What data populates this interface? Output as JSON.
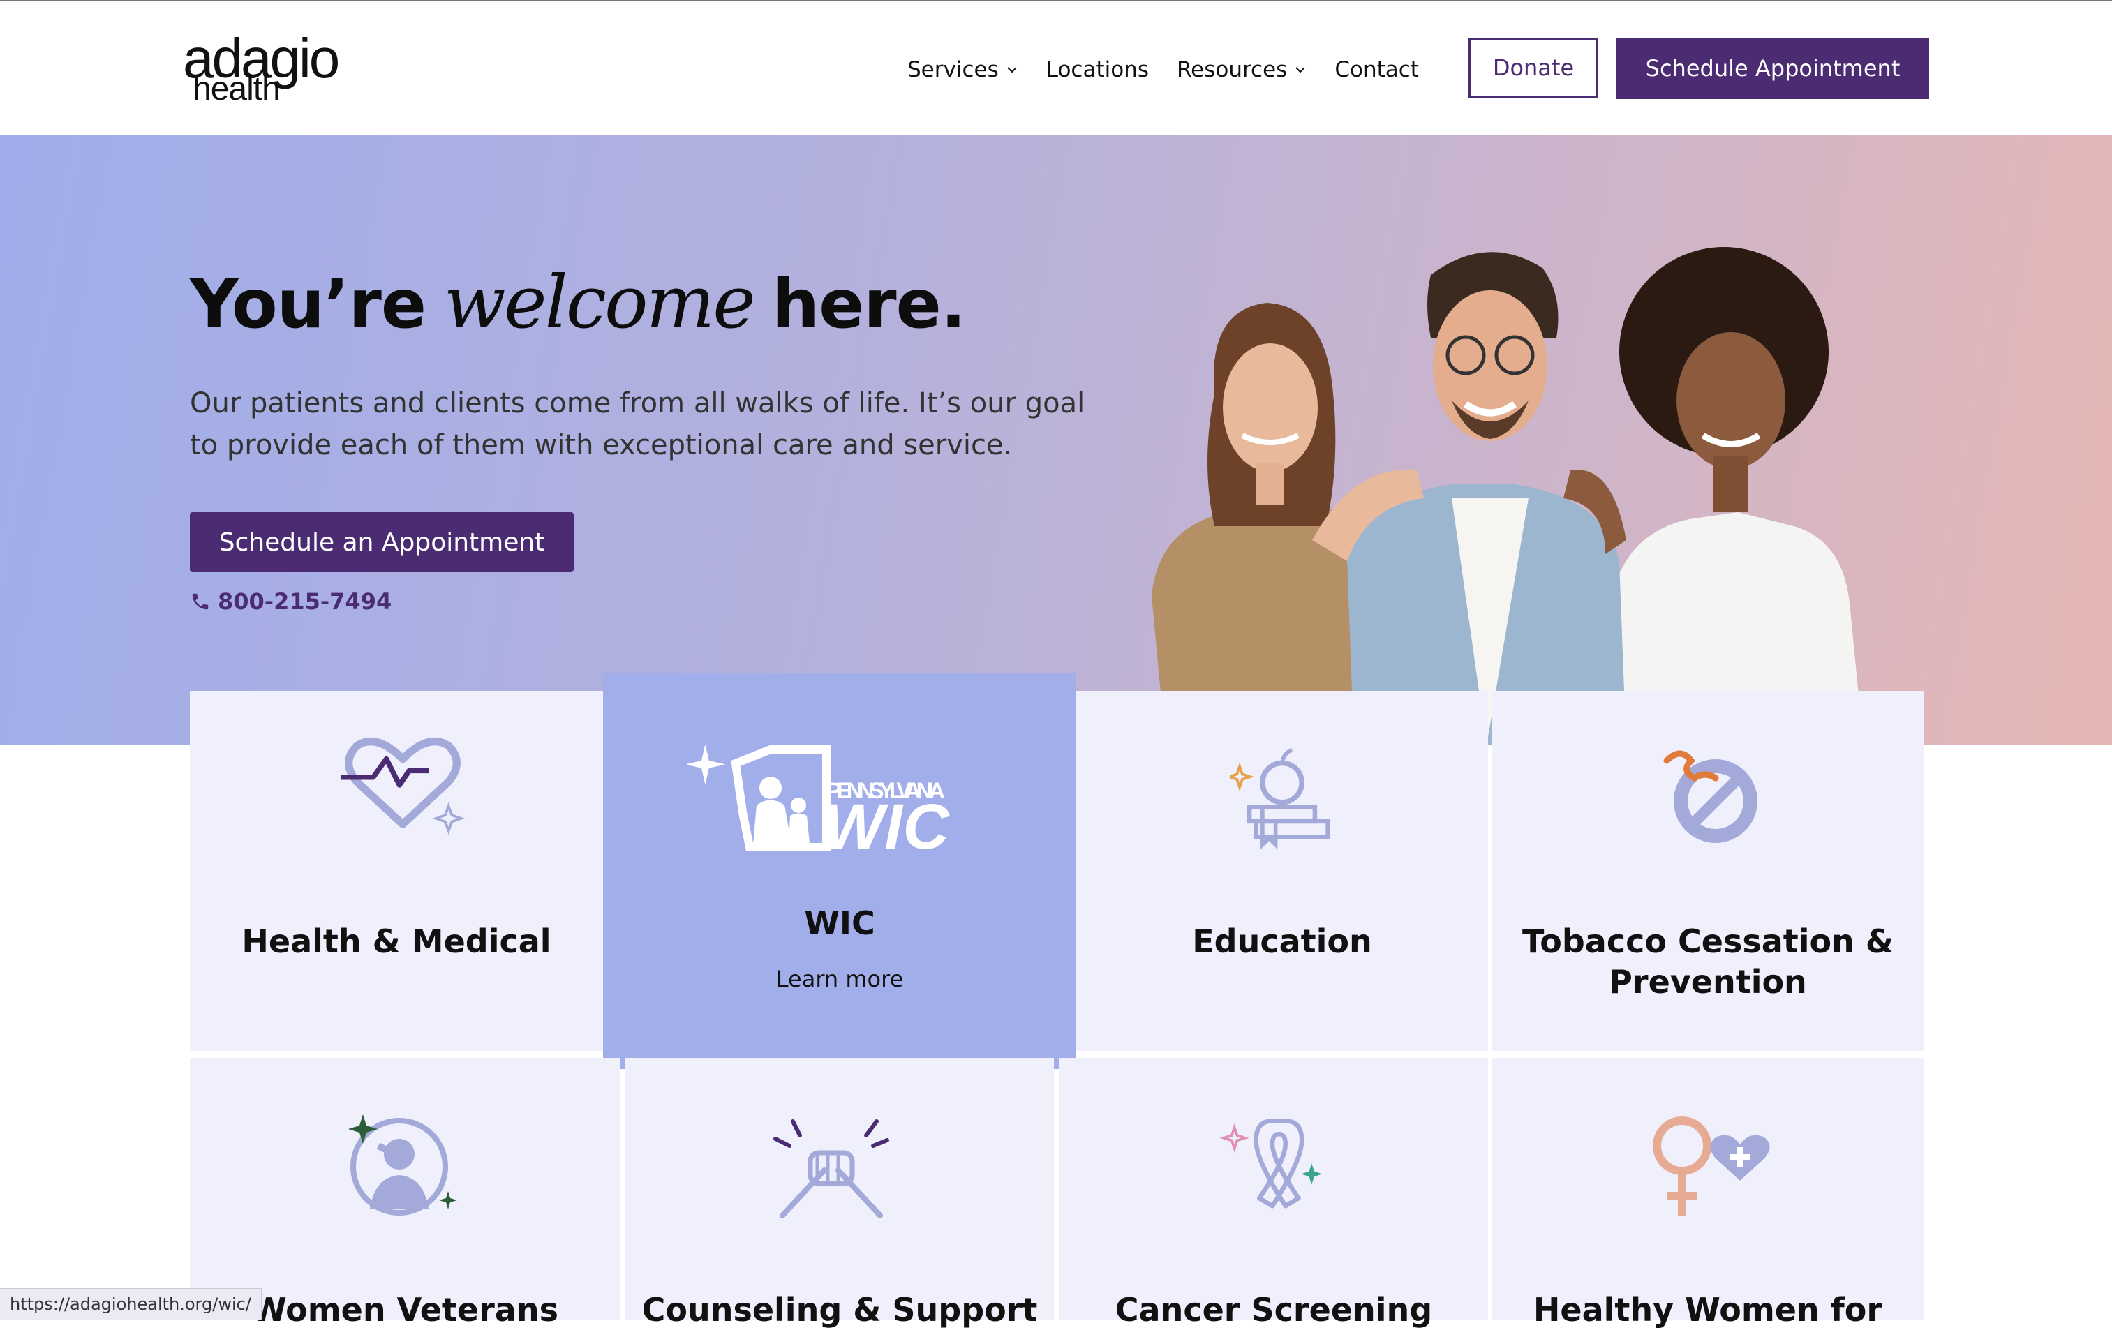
{
  "brand": {
    "logo_line1": "adagio",
    "logo_line2": "health"
  },
  "nav": {
    "items": [
      {
        "label": "Services",
        "dropdown": true
      },
      {
        "label": "Locations",
        "dropdown": false
      },
      {
        "label": "Resources",
        "dropdown": true
      },
      {
        "label": "Contact",
        "dropdown": false
      }
    ],
    "donate_label": "Donate",
    "schedule_label": "Schedule Appointment"
  },
  "hero": {
    "title_before": "You’re",
    "title_script": "welcome",
    "title_after": "here.",
    "text": "Our patients and clients come from all walks of life. It’s our goal to provide each of them with exceptional care and service.",
    "cta_label": "Schedule an Appointment",
    "phone": "800-215-7494"
  },
  "services": [
    {
      "title": "Health & Medical",
      "icon": "heart-pulse-icon"
    },
    {
      "title": "WIC",
      "icon": "pennsylvania-wic-logo",
      "logo_text_top": "PENNSYLVANIA",
      "logo_text_main": "WIC",
      "link_label": "Learn more",
      "featured": true
    },
    {
      "title": "Education",
      "icon": "apple-books-icon"
    },
    {
      "title": "Tobacco Cessation & Prevention",
      "icon": "no-smoking-icon"
    },
    {
      "title": "Women Veterans",
      "icon": "saluting-veteran-icon"
    },
    {
      "title": "Counseling & Support",
      "icon": "clasped-hands-icon"
    },
    {
      "title": "Cancer Screening",
      "icon": "awareness-ribbon-icon"
    },
    {
      "title": "Healthy Women for",
      "icon": "female-symbol-heart-icon"
    }
  ],
  "status_bar": {
    "url": "https://adagiohealth.org/wic/"
  },
  "colors": {
    "primary": "#4b2c72",
    "card_bg": "#eff0fc",
    "featured_bg": "#a2aeea",
    "icon": "#a3aad9"
  }
}
